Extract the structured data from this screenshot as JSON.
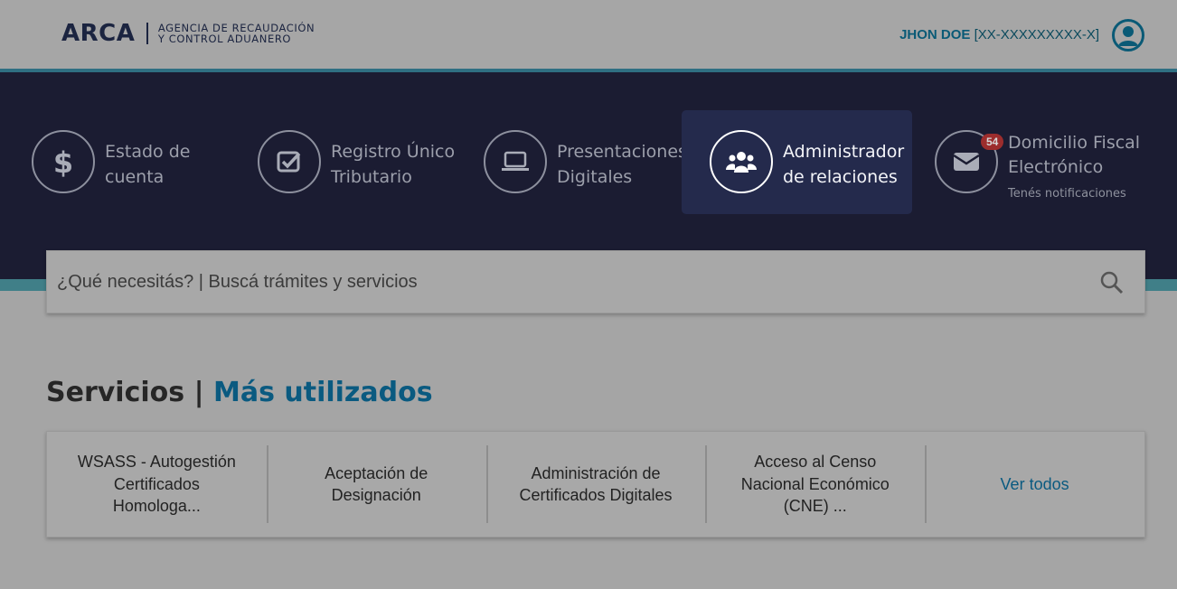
{
  "header": {
    "logo": "ARCA",
    "logo_sub_line1": "AGENCIA DE RECAUDACIÓN",
    "logo_sub_line2": "Y CONTROL ADUANERO",
    "user_name": "JHON DOE",
    "user_id": "[XX-XXXXXXXXX-X]"
  },
  "nav": {
    "items": [
      {
        "line1": "Estado de",
        "line2": "cuenta",
        "icon": "dollar-icon"
      },
      {
        "line1": "Registro Único",
        "line2": "Tributario",
        "icon": "checkbox-icon"
      },
      {
        "line1": "Presentaciones",
        "line2": "Digitales",
        "icon": "laptop-icon"
      },
      {
        "line1": "Administrador",
        "line2": "de relaciones",
        "icon": "people-icon",
        "active": true
      },
      {
        "line1": "Domicilio Fiscal",
        "line2": "Electrónico",
        "sub": "Tenés notificaciones",
        "badge": "54",
        "icon": "envelope-icon"
      }
    ]
  },
  "search": {
    "placeholder": "¿Qué necesitás? | Buscá trámites y servicios"
  },
  "services": {
    "title_a": "Servicios |",
    "title_b": "Más utilizados",
    "cards": [
      {
        "line1": "WSASS - Autogestión",
        "line2": "Certificados",
        "line3": "Homologa..."
      },
      {
        "line1": "Aceptación de",
        "line2": "Designación"
      },
      {
        "line1": "Administración de",
        "line2": "Certificados Digitales"
      },
      {
        "line1": "Acceso al Censo",
        "line2": "Nacional Económico",
        "line3": "(CNE) ..."
      },
      {
        "line1": "Ver todos"
      }
    ]
  },
  "colors": {
    "nav_bg": "#1b1c32",
    "nav_active": "#242a4c",
    "accent": "#0a5a80",
    "badge": "#9c2d2d"
  }
}
